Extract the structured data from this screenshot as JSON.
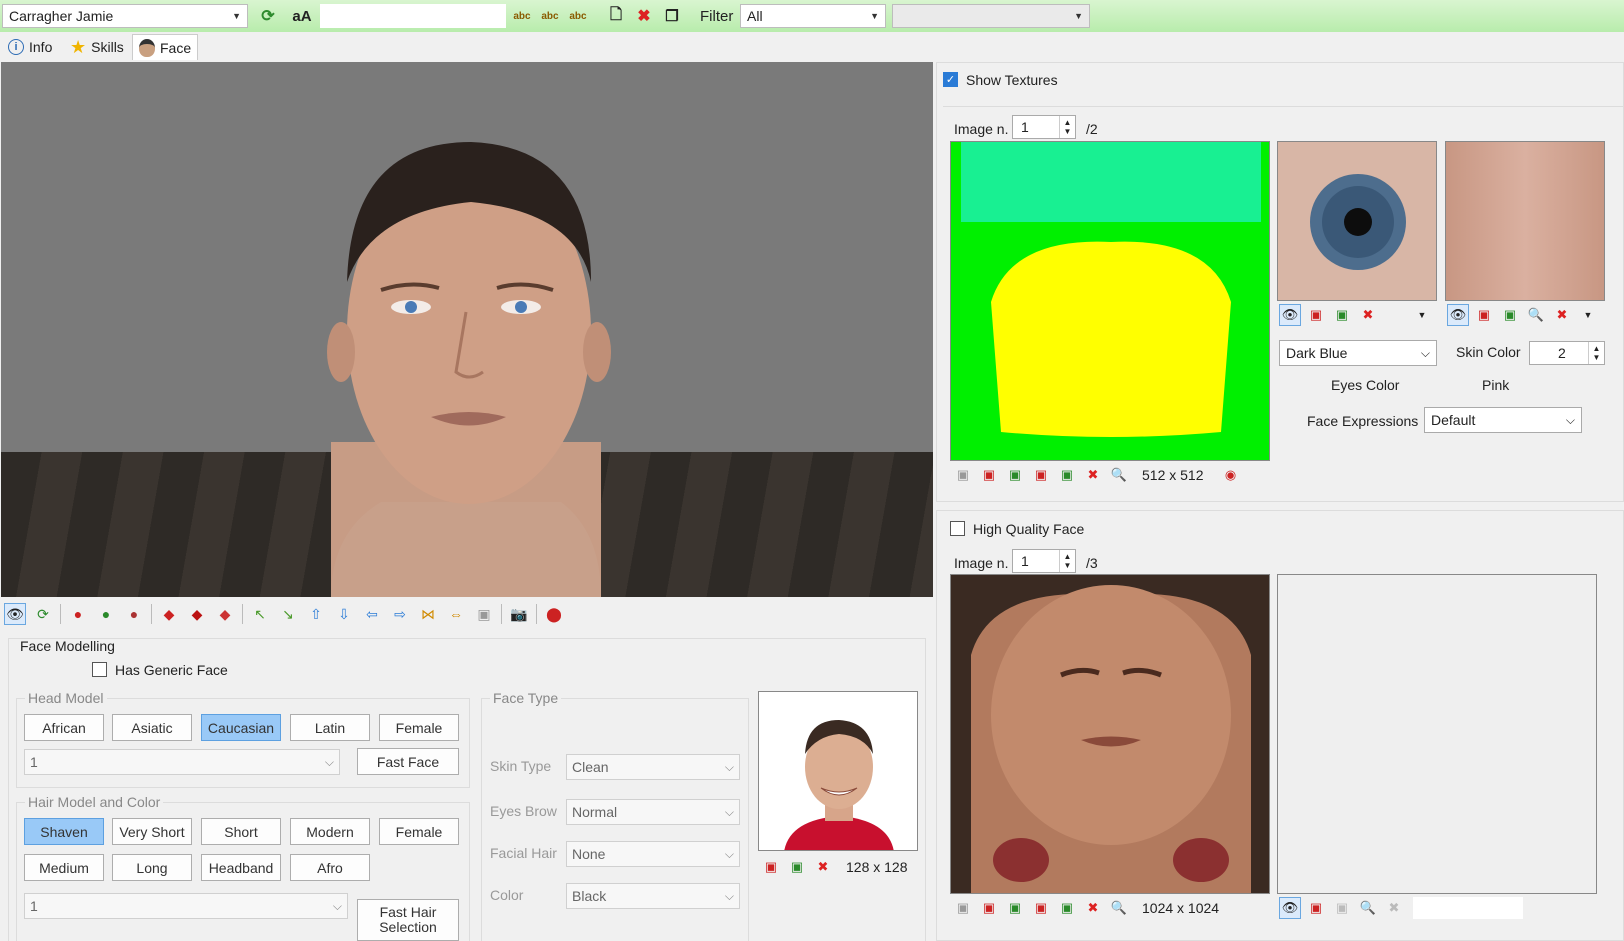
{
  "toolbar": {
    "player": "Carragher Jamie",
    "aa_label": "aA",
    "filter_label": "Filter",
    "filter_value": "All"
  },
  "tabs": [
    {
      "label": "Info",
      "icon": "info-icon"
    },
    {
      "label": "Skills",
      "icon": "star-icon"
    },
    {
      "label": "Face",
      "icon": "face-icon"
    }
  ],
  "face_modelling": {
    "title": "Face Modelling",
    "generic_face": "Has Generic Face",
    "head_model_legend": "Head Model",
    "head_models": [
      "African",
      "Asiatic",
      "Caucasian",
      "Latin",
      "Female"
    ],
    "head_selected": "Caucasian",
    "head_number": "1",
    "fast_face": "Fast Face",
    "hair_legend": "Hair Model and Color",
    "hair_row1": [
      "Shaven",
      "Very Short",
      "Short",
      "Modern",
      "Female"
    ],
    "hair_row2": [
      "Medium",
      "Long",
      "Headband",
      "Afro"
    ],
    "hair_selected": "Shaven",
    "hair_number": "1",
    "fast_hair": "Fast Hair Selection"
  },
  "face_type": {
    "legend": "Face Type",
    "fields": [
      {
        "label": "Skin Type",
        "value": "Clean"
      },
      {
        "label": "Eyes Brow",
        "value": "Normal"
      },
      {
        "label": "Facial Hair",
        "value": "None"
      },
      {
        "label": "Color",
        "value": "Black"
      }
    ]
  },
  "photo": {
    "size": "128 x 128"
  },
  "textures": {
    "show_textures": "Show Textures",
    "image_label": "Image n.",
    "image_value": "1",
    "image_total": "/2",
    "size": "512 x 512",
    "eyes_color_value": "Dark Blue",
    "eyes_color_label": "Eyes Color",
    "skin_color_label": "Skin Color",
    "skin_color_value": "2",
    "skin_color_name": "Pink",
    "face_expressions_label": "Face Expressions",
    "face_expressions_value": "Default"
  },
  "hq": {
    "label": "High Quality Face",
    "image_label": "Image n.",
    "image_value": "1",
    "image_total": "/3",
    "size": "1024 x 1024"
  }
}
